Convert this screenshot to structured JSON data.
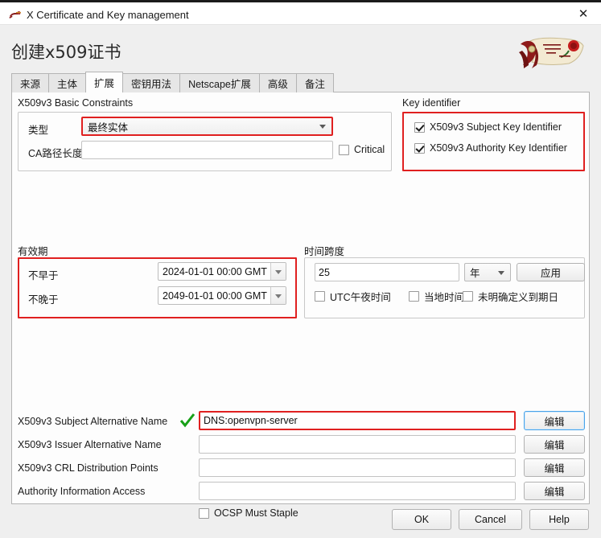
{
  "window": {
    "title": "X Certificate and Key management",
    "icon": "certificate-scroll-icon",
    "close_label": "✕"
  },
  "heading": "创建x509证书",
  "logo_name": "xca-certificate-logo",
  "tabs": [
    {
      "label": "来源",
      "name": "tab-source",
      "active": false
    },
    {
      "label": "主体",
      "name": "tab-subject",
      "active": false
    },
    {
      "label": "扩展",
      "name": "tab-extensions",
      "active": true
    },
    {
      "label": "密钥用法",
      "name": "tab-key-usage",
      "active": false
    },
    {
      "label": "Netscape扩展",
      "name": "tab-netscape",
      "active": false
    },
    {
      "label": "高级",
      "name": "tab-advanced",
      "active": false
    },
    {
      "label": "备注",
      "name": "tab-comment",
      "active": false
    }
  ],
  "basic_constraints": {
    "group_title": "X509v3 Basic Constraints",
    "type_label": "类型",
    "type_value": "最终实体",
    "path_len_label": "CA路径长度",
    "path_len_value": "",
    "critical_label": "Critical",
    "critical_checked": false
  },
  "key_identifier": {
    "group_title": "Key identifier",
    "subject_kid_label": "X509v3 Subject Key Identifier",
    "subject_kid_checked": true,
    "authority_kid_label": "X509v3 Authority Key Identifier",
    "authority_kid_checked": true
  },
  "validity": {
    "group_title": "有效期",
    "not_before_label": "不早于",
    "not_before_value": "2024-01-01 00:00 GMT",
    "not_after_label": "不晚于",
    "not_after_value": "2049-01-01 00:00 GMT"
  },
  "time_range": {
    "group_title": "时间跨度",
    "amount_value": "25",
    "unit_value": "年",
    "apply_label": "应用",
    "midnight_label": "UTC午夜时间",
    "midnight_checked": false,
    "local_label": "当地时间",
    "local_checked": false,
    "no_wellknown_label": "未明确定义到期日",
    "no_wellknown_checked": false
  },
  "extensions": {
    "rows": [
      {
        "label": "X509v3 Subject Alternative Name",
        "value": "DNS:openvpn-server",
        "button": "编辑",
        "valid_mark": true,
        "highlight": true,
        "button_focus": true
      },
      {
        "label": "X509v3 Issuer Alternative Name",
        "value": "",
        "button": "编辑",
        "valid_mark": false,
        "highlight": false,
        "button_focus": false
      },
      {
        "label": "X509v3 CRL Distribution Points",
        "value": "",
        "button": "编辑",
        "valid_mark": false,
        "highlight": false,
        "button_focus": false
      },
      {
        "label": "Authority Information Access",
        "value": "",
        "button": "编辑",
        "valid_mark": false,
        "highlight": false,
        "button_focus": false
      }
    ],
    "ocsp_label": "OCSP Must Staple",
    "ocsp_checked": false
  },
  "footer": {
    "ok": "OK",
    "cancel": "Cancel",
    "help": "Help"
  },
  "colors": {
    "highlight_red": "#e02020",
    "valid_green": "#18a018",
    "focus_blue": "#4aa3e8"
  }
}
